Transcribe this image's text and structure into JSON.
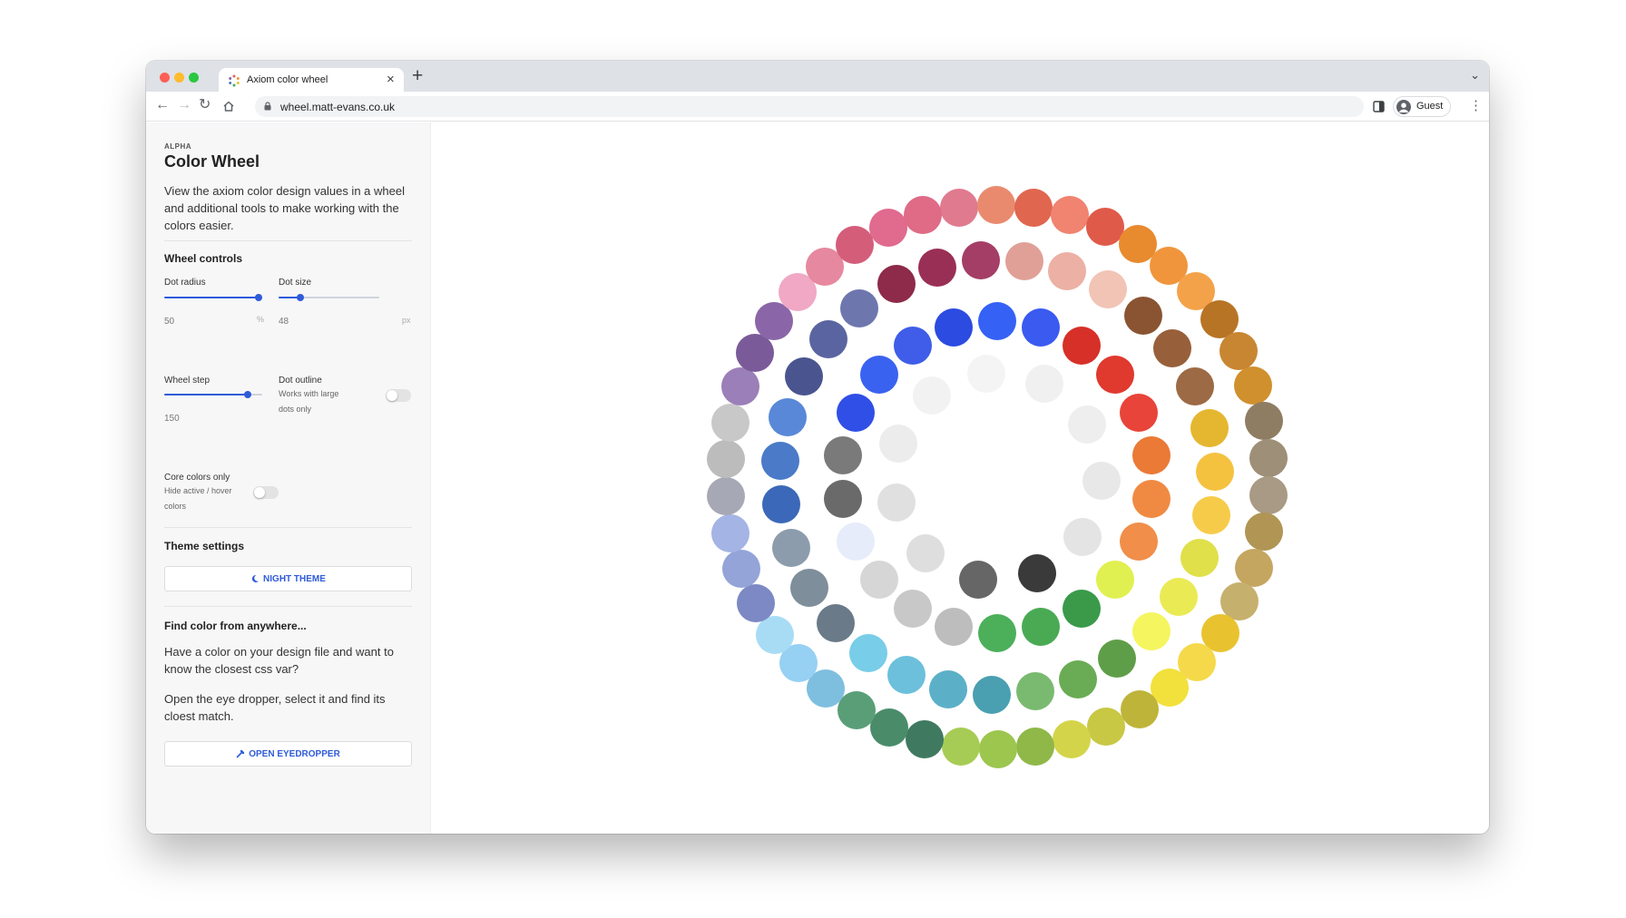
{
  "browser": {
    "tab_title": "Axiom color wheel",
    "tab_close": "×",
    "new_tab": "+",
    "tab_menu": "⌄",
    "url": "wheel.matt-evans.co.uk",
    "nav": {
      "back": "←",
      "forward": "→",
      "reload": "↻",
      "menu": "⋮"
    },
    "profile_label": "Guest",
    "traffic_colors": [
      "#ff5f57",
      "#febc2e",
      "#28c840"
    ]
  },
  "sidebar": {
    "eyebrow": "ALPHA",
    "title": "Color Wheel",
    "description": "View the axiom color design values in a wheel and additional tools to make working with the colors easier.",
    "wheel_controls": {
      "heading": "Wheel controls",
      "dot_radius": {
        "label": "Dot radius",
        "value": "50",
        "unit": "%",
        "fraction": 1.0
      },
      "dot_size": {
        "label": "Dot size",
        "value": "48",
        "unit": "px",
        "fraction": 0.2
      },
      "wheel_step": {
        "label": "Wheel step",
        "value": "150",
        "fraction": 0.85
      },
      "dot_outline": {
        "label": "Dot outline",
        "hint": "Works with large dots only",
        "on": false
      },
      "core_colors": {
        "label": "Core colors only",
        "hint": "Hide active / hover colors",
        "on": false
      }
    },
    "theme": {
      "heading": "Theme settings",
      "button_label": "NIGHT THEME",
      "icon": "moon-icon"
    },
    "finder": {
      "heading": "Find color from anywhere...",
      "text1": "Have a color on your design file and want to know the closest css var?",
      "text2": "Open the eye dropper, select it and find its cloest match.",
      "button_label": "OPEN EYEDROPPER",
      "icon": "eyedropper-icon"
    }
  },
  "wheel": {
    "accent": "#2f5bd9",
    "outer_ring": [
      "#e07a8f",
      "#e98a6f",
      "#e06650",
      "#f08470",
      "#e05a4a",
      "#e88a2e",
      "#f0953c",
      "#f4a24a",
      "#b87425",
      "#c88632",
      "#d0902e",
      "#8f7d63",
      "#9e8f78",
      "#a89a84",
      "#b09555",
      "#c4a660",
      "#c6b06e",
      "#e8c32f",
      "#f5d94a",
      "#f2e03c",
      "#bfb43a",
      "#c8c845",
      "#d4d44a",
      "#8fb848",
      "#9cc64e",
      "#a6cc55",
      "#3f7a60",
      "#4a8c6a",
      "#5a9e78",
      "#7ebfe0",
      "#96d0f2",
      "#a8dcf5",
      "#7c89c4",
      "#94a4d8",
      "#a4b4e4",
      "#a6a8b5",
      "#bcbcbc",
      "#c8c8c8",
      "#9b7fb8",
      "#7a5a98",
      "#8a66a8",
      "#f0a8c4",
      "#e6889f",
      "#d45d7a",
      "#e06b8e",
      "#df6b86"
    ],
    "middle_ring": [
      "#9a2f55",
      "#a43e66",
      "#e0a098",
      "#ecb0a4",
      "#f2c4b6",
      "#8a5432",
      "#98603a",
      "#9c6a44",
      "#e5b730",
      "#f5c240",
      "#f7cb4a",
      "#e0e04a",
      "#eaea55",
      "#f5f560",
      "#5f9e48",
      "#6aac55",
      "#7aba70",
      "#4aa0b0",
      "#5bb0c8",
      "#6cc0dc",
      "#78cde8",
      "#6a7a88",
      "#7e8e9a",
      "#8c9cac",
      "#3b68b8",
      "#4a7ac8",
      "#5a88d8",
      "#4a5590",
      "#5a64a0",
      "#6e76ae",
      "#8e2a4a"
    ],
    "inner_ring": [
      "#3561f5",
      "#3a5af0",
      "#d63028",
      "#e0392e",
      "#e8443a",
      "#ea7a36",
      "#f08a42",
      "#f08e4a",
      "#e0f050",
      "#3a9a4a",
      "#4aaa54",
      "#4caf5a",
      "#bdbdbd",
      "#c8c8c8",
      "#d6d6d6",
      "#e6ecfa",
      "#6a6a6a",
      "#7a7a7a",
      "#2f4fe6",
      "#3a62f0",
      "#3f5de8",
      "#2c4be0"
    ],
    "innermost_ring": [
      "#f4f4f4",
      "#f0f0f0",
      "#eeeeee",
      "#e8e8e8",
      "#e4e4e4",
      "#3a3a3a",
      "#666666",
      "#dedede",
      "#e0e0e0",
      "#ececec",
      "#f2f2f2"
    ]
  }
}
